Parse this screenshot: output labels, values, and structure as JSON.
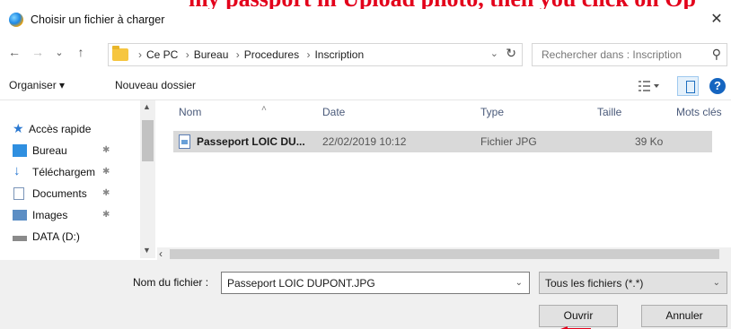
{
  "banner": {
    "text": "my passport in Upload photo, then you click on Op"
  },
  "window": {
    "title": "Choisir un fichier à charger",
    "close_glyph": "✕"
  },
  "nav": {
    "back_glyph": "←",
    "forward_glyph": "→",
    "recent_glyph": "⌄",
    "up_glyph": "↑",
    "breadcrumbs": [
      "Ce PC",
      "Bureau",
      "Procedures",
      "Inscription"
    ],
    "search_placeholder": "Rechercher dans : Inscription"
  },
  "toolbar": {
    "organize_label": "Organiser ▾",
    "new_folder_label": "Nouveau dossier",
    "help_glyph": "?"
  },
  "sidebar": {
    "items": [
      {
        "label": "Accès rapide",
        "icon": "star-icon"
      },
      {
        "label": "Bureau",
        "icon": "desktop-icon"
      },
      {
        "label": "Téléchargem",
        "icon": "download-icon"
      },
      {
        "label": "Documents",
        "icon": "documents-icon"
      },
      {
        "label": "Images",
        "icon": "images-icon"
      },
      {
        "label": "DATA (D:)",
        "icon": "drive-icon"
      }
    ]
  },
  "files": {
    "columns": [
      "Nom",
      "Date",
      "Type",
      "Taille",
      "Mots clés"
    ],
    "rows": [
      {
        "name": "Passeport LOIC DU...",
        "date": "22/02/2019 10:12",
        "type": "Fichier JPG",
        "size": "39 Ko",
        "icon": "jpg-file-icon"
      }
    ]
  },
  "footer": {
    "filename_label": "Nom du fichier :",
    "filename_value": "Passeport LOIC DUPONT.JPG",
    "filetype_value": "Tous les fichiers (*.*)",
    "open_label": "Ouvrir",
    "cancel_label": "Annuler"
  },
  "colors": {
    "banner": "#e3001b",
    "selection": "#d9d9d9",
    "accent": "#1565c0"
  }
}
